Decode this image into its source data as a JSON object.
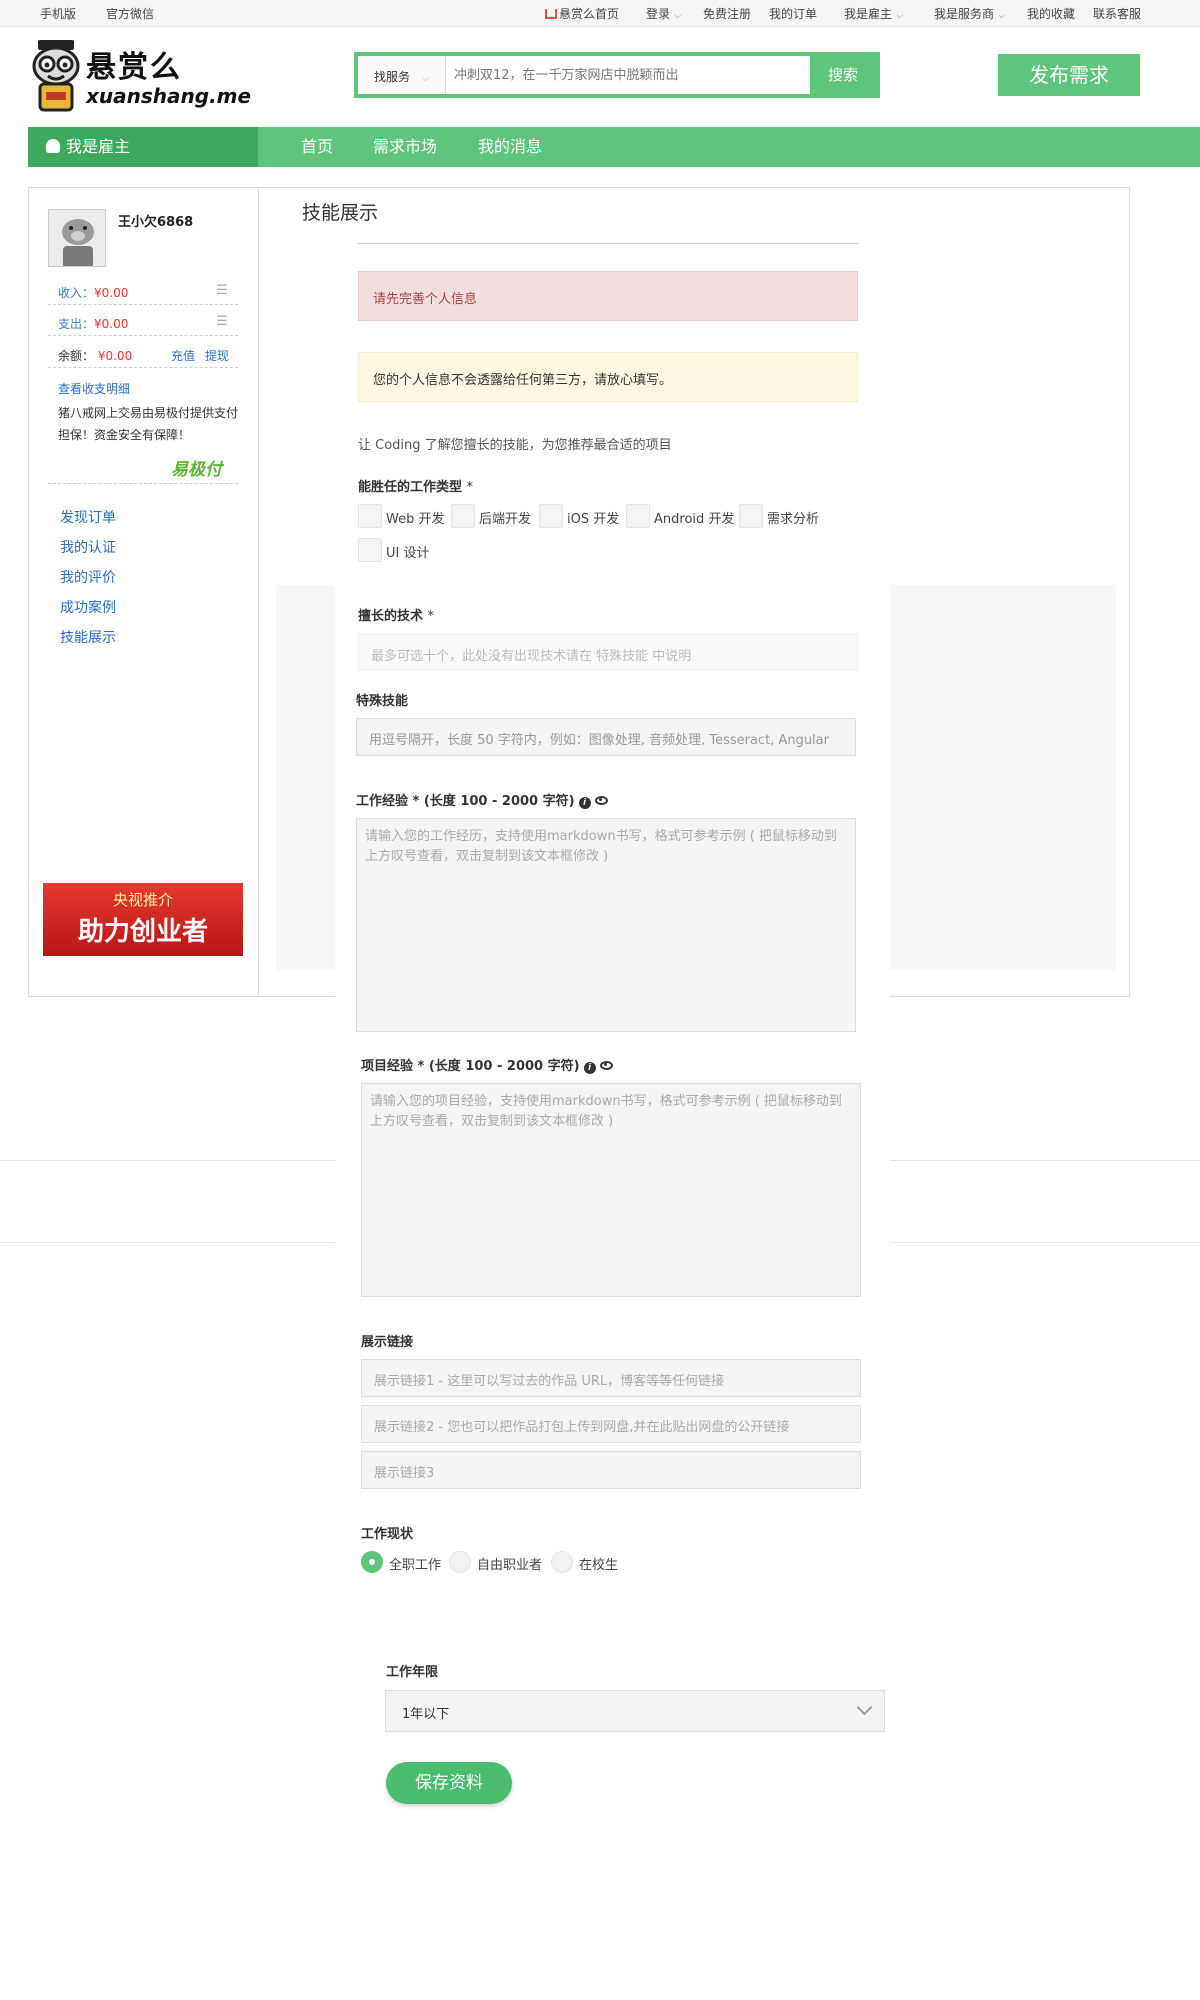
{
  "topbar": {
    "mobile": "手机版",
    "wechat": "官方微信",
    "home": "悬赏么首页",
    "login": "登录",
    "register": "免费注册",
    "orders": "我的订单",
    "employer": "我是雇主",
    "provider": "我是服务商",
    "favorites": "我的收藏",
    "support": "联系客服"
  },
  "logo": {
    "cn": "悬赏么",
    "en": "xuanshang.me"
  },
  "search": {
    "category": "找服务",
    "placeholder": "冲刺双12，在一千万家网店中脱颖而出",
    "button": "搜索"
  },
  "publish_label": "发布需求",
  "nav": {
    "role": "我是雇主",
    "items": [
      "首页",
      "需求市场",
      "我的消息"
    ]
  },
  "sidebar": {
    "username": "王小欠6868",
    "income_label": "收入：",
    "income_value": "¥0.00",
    "expense_label": "支出：",
    "expense_value": "¥0.00",
    "balance_label": "余额：",
    "balance_value": "¥0.00",
    "recharge": "充值",
    "withdraw": "提现",
    "details_link": "查看收支明细",
    "note": "猪八戒网上交易由易极付提供支付担保！资金安全有保障！",
    "yjf_logo": "易极付",
    "menu": [
      "发现订单",
      "我的认证",
      "我的评价",
      "成功案例",
      "技能展示"
    ],
    "banner_top": "央视推介",
    "banner_main": "助力创业者"
  },
  "page": {
    "title": "技能展示",
    "alert_error": "请先完善个人信息",
    "alert_warning": "您的个人信息不会透露给任何第三方，请放心填写。",
    "intro": "让 Coding 了解您擅长的技能，为您推荐最合适的项目"
  },
  "form": {
    "work_types_label": "能胜任的工作类型",
    "work_types": [
      "Web 开发",
      "后端开发",
      "iOS 开发",
      "Android 开发",
      "需求分析",
      "UI 设计"
    ],
    "skills_label": "擅长的技术",
    "skills_placeholder": "最多可选十个，此处没有出现技术请在 特殊技能 中说明",
    "special_label": "特殊技能",
    "special_placeholder": "用逗号隔开，长度 50 字符内，例如：图像处理, 音频处理, Tesseract, Angular",
    "work_exp_label": "工作经验 * (长度 100 - 2000 字符)",
    "work_exp_placeholder": "请输入您的工作经历，支持使用markdown书写，格式可参考示例 ( 把鼠标移动到上方叹号查看，双击复制到该文本框修改 )",
    "project_exp_label": "项目经验 * (长度 100 - 2000 字符)",
    "project_exp_placeholder": "请输入您的项目经验，支持使用markdown书写，格式可参考示例 ( 把鼠标移动到上方叹号查看，双击复制到该文本框修改 )",
    "links_label": "展示链接",
    "links": [
      "展示链接1 - 这里可以写过去的作品 URL，博客等等任何链接",
      "展示链接2 - 您也可以把作品打包上传到网盘,并在此贴出网盘的公开链接",
      "展示链接3"
    ],
    "status_label": "工作现状",
    "status_options": [
      "全职工作",
      "自由职业者",
      "在校生"
    ],
    "status_selected": "全职工作",
    "years_label": "工作年限",
    "years_value": "1年以下",
    "save_label": "保存资料"
  }
}
